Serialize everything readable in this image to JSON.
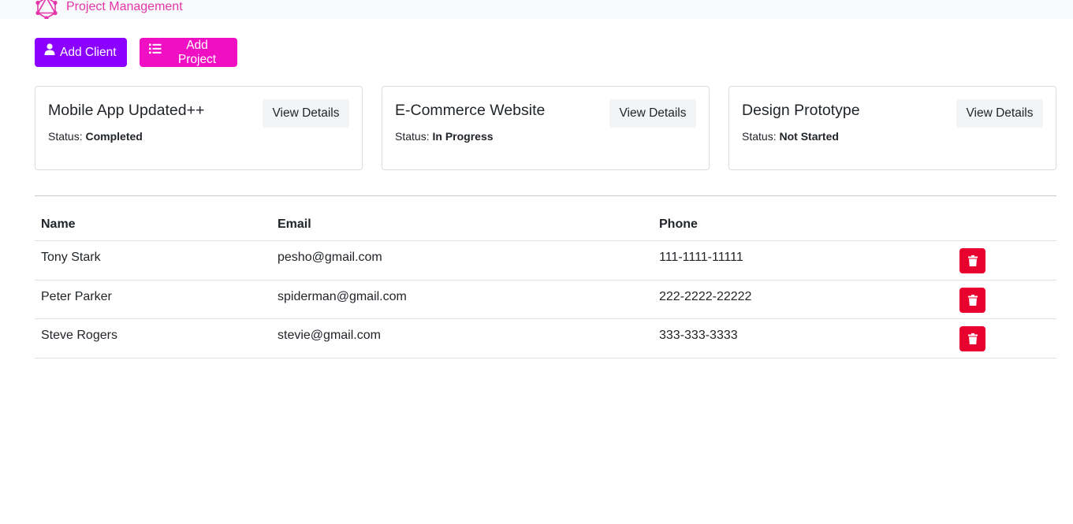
{
  "navbar": {
    "brand_text": "Project Management",
    "brand_icon": "graphql-logo-icon",
    "brand_color": "#e535ab"
  },
  "actions": {
    "add_client_label": "Add Client",
    "add_project_label": "Add Project",
    "add_client_color": "#8b00ff",
    "add_project_color": "#f00fc3"
  },
  "projects": [
    {
      "name": "Mobile App Updated++",
      "status_label": "Status:",
      "status": "Completed",
      "button": "View Details"
    },
    {
      "name": "E-Commerce Website",
      "status_label": "Status:",
      "status": "In Progress",
      "button": "View Details"
    },
    {
      "name": "Design Prototype",
      "status_label": "Status:",
      "status": "Not Started",
      "button": "View Details"
    }
  ],
  "clients_table": {
    "headers": {
      "name": "Name",
      "email": "Email",
      "phone": "Phone"
    },
    "rows": [
      {
        "name": "Tony Stark",
        "email": "pesho@gmail.com",
        "phone": "111-1111-11111"
      },
      {
        "name": "Peter Parker",
        "email": "spiderman@gmail.com",
        "phone": "222-2222-22222"
      },
      {
        "name": "Steve Rogers",
        "email": "stevie@gmail.com",
        "phone": "333-333-3333"
      }
    ],
    "delete_icon": "trash-icon",
    "delete_color": "#e8002f"
  }
}
